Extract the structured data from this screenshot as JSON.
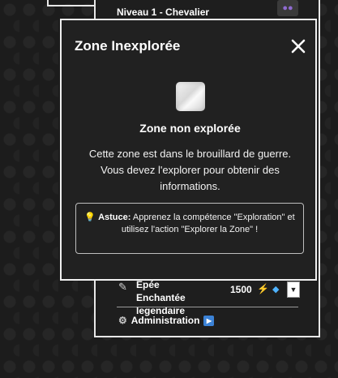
{
  "background_panel": {
    "level_text": "Niveau 1 - Chevalier",
    "item": {
      "name": "Epée Enchantée legendaire",
      "price": "1500"
    },
    "admin_label": "Administration"
  },
  "modal": {
    "title": "Zone Inexplorée",
    "close_symbol": "✕",
    "heading": "Zone non explorée",
    "description": "Cette zone est dans le brouillard de guerre. Vous devez l'explorer pour obtenir des informations.",
    "tip": {
      "label": "Astuce:",
      "text": "Apprenez la compétence \"Exploration\" et utilisez l'action \"Explorer la Zone\" !"
    }
  },
  "icons": {
    "badge": "users-icon",
    "item": "sword-icon",
    "cost": "lightning-icon",
    "gem": "diamond-icon",
    "admin": "gear-icon",
    "admin_action": "play-icon",
    "tip": "lightbulb-icon",
    "zone": "fog-image"
  },
  "colors": {
    "modal_bg": "#212121",
    "border": "#f0f0f0",
    "bolt": "#f07a2a",
    "gem": "#4fb3ff",
    "badge": "#8f6bd1"
  }
}
